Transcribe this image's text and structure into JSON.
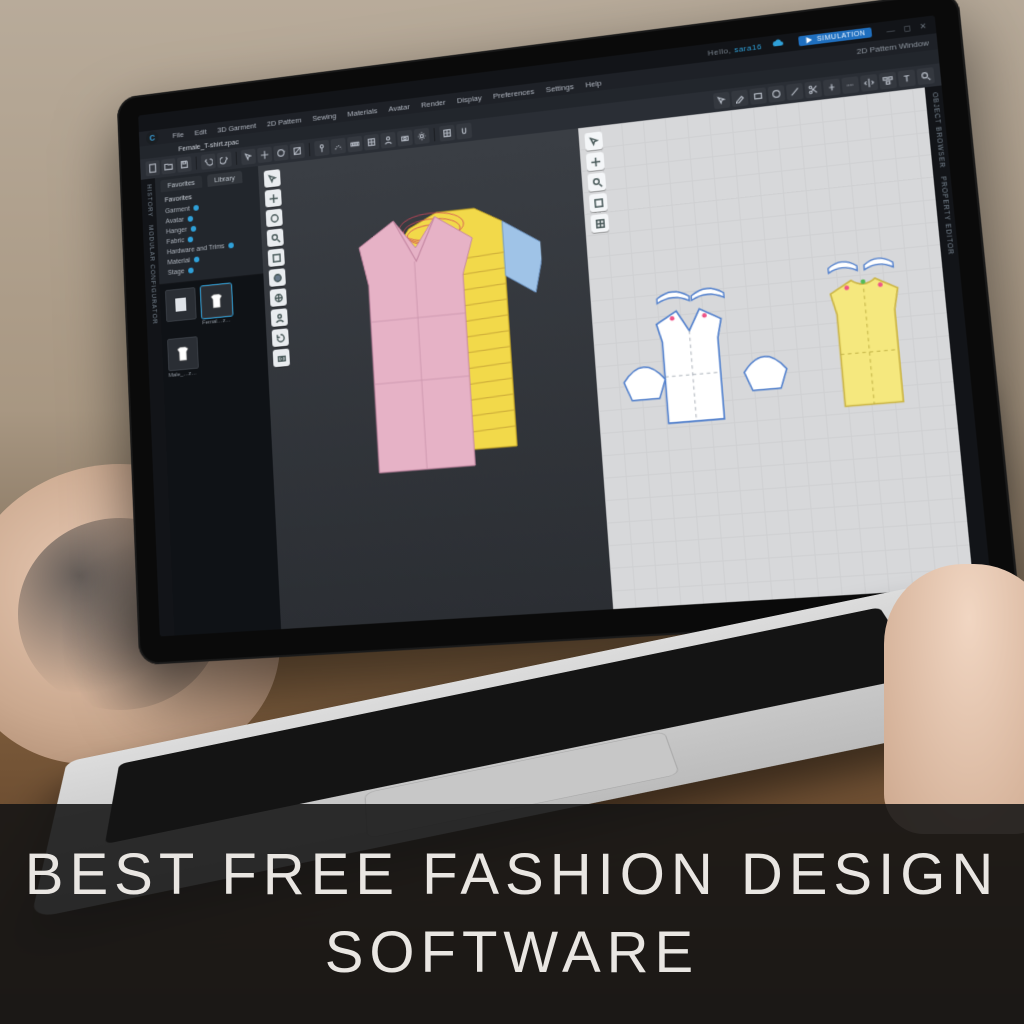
{
  "caption": "BEST FREE FASHION DESIGN SOFTWARE",
  "titlebar": {
    "hello": "Hello,",
    "user": "sara16",
    "simulation_label": "SIMULATION"
  },
  "menu": {
    "items": [
      "File",
      "Edit",
      "3D Garment",
      "2D Pattern",
      "Sewing",
      "Materials",
      "Avatar",
      "Render",
      "Display",
      "Preferences",
      "Settings",
      "Help"
    ],
    "right_pane_title": "2D Pattern Window"
  },
  "document": {
    "title": "Female_T-shirt.zpac"
  },
  "left_side": {
    "vertical_labels": [
      "HISTORY",
      "MODULAR CONFIGURATOR"
    ]
  },
  "right_side": {
    "vertical_labels": [
      "OBJECT BROWSER",
      "PROPERTY EDITOR"
    ]
  },
  "library": {
    "tabs": [
      "Favorites",
      "Library"
    ],
    "active_tab": "Library",
    "favorites_heading": "Favorites",
    "items": [
      "Garment",
      "Avatar",
      "Hanger",
      "Fabric",
      "Hardware and Trims",
      "Material",
      "Stage"
    ]
  },
  "browser": {
    "thumbs_row1": [
      {
        "label": "",
        "icon": "blank"
      },
      {
        "label": "Femal…zpac",
        "icon": "tee",
        "selected": true
      }
    ],
    "thumbs_row2": [
      {
        "label": "Male_…zpac",
        "icon": "tee"
      }
    ]
  },
  "colors": {
    "accent": "#2fa0d8",
    "panel_dark": "#22262c",
    "panel_darker": "#121418",
    "garment_pink": "#e6b2c6",
    "garment_yellow": "#f2d94a",
    "garment_blue": "#9fc3e7"
  }
}
